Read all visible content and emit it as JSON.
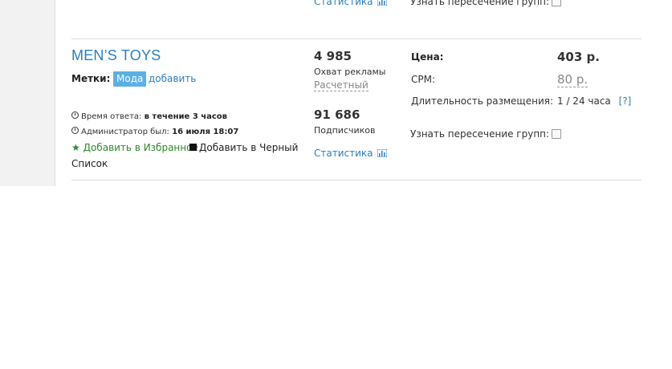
{
  "previous_row": {
    "stats_link": "Статистика",
    "intersect_label": "Узнать пересечение групп:"
  },
  "group": {
    "title": "MEN’S TOYS",
    "tags_label": "Метки:",
    "tag": "Мода",
    "tag_add": "добавить",
    "response_label": "Время ответа:",
    "response_value": "в течение 3 часов",
    "admin_label": "Администратор был:",
    "admin_value": "16 июля 18:07",
    "favorite_label": "Добавить в Избранное",
    "blacklist_label_1": "Добавить в Черный",
    "blacklist_label_2": "Список"
  },
  "metrics": {
    "reach_value": "4 985",
    "reach_label": "Охват рекламы",
    "reach_note": "Расчетный",
    "subscribers_value": "91 686",
    "subscribers_label": "Подписчиков",
    "stats_link": "Статистика"
  },
  "pricing": {
    "price_label": "Цена:",
    "price_value": "403 р.",
    "cpm_label": "CPM:",
    "cpm_value": "80 р.",
    "duration_label": "Длительность размещения:",
    "duration_value": "1 / 24 часа",
    "help_link": "[?]",
    "intersect_label": "Узнать пересечение групп:"
  },
  "colors": {
    "link": "#2a7fc0",
    "tag_bg": "#5ab0e6",
    "favorite": "#2c8a2c"
  },
  "icons": {
    "clock": "clock-icon",
    "star": "star-icon",
    "square": "black-square-icon",
    "chart": "bar-chart-icon"
  }
}
